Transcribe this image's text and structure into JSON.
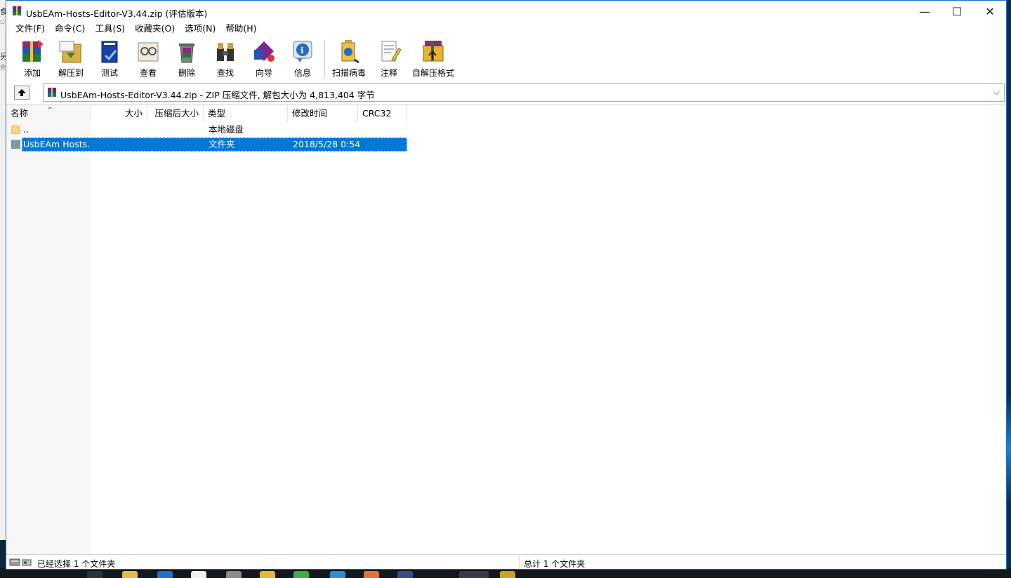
{
  "window": {
    "title": "UsbEAm-Hosts-Editor-V3.44.zip (评估版本)",
    "controls": {
      "minimize": "—",
      "maximize": "☐",
      "close": "✕"
    }
  },
  "menu": [
    {
      "label": "文件(F)"
    },
    {
      "label": "命令(C)"
    },
    {
      "label": "工具(S)"
    },
    {
      "label": "收藏夹(O)"
    },
    {
      "label": "选项(N)"
    },
    {
      "label": "帮助(H)"
    }
  ],
  "toolbar": [
    {
      "label": "添加",
      "icon": "add-archive-icon"
    },
    {
      "label": "解压到",
      "icon": "extract-to-icon"
    },
    {
      "label": "测试",
      "icon": "test-icon"
    },
    {
      "label": "查看",
      "icon": "view-icon"
    },
    {
      "label": "删除",
      "icon": "delete-icon"
    },
    {
      "label": "查找",
      "icon": "find-icon"
    },
    {
      "label": "向导",
      "icon": "wizard-icon"
    },
    {
      "label": "信息",
      "icon": "info-icon"
    },
    {
      "label": "扫描病毒",
      "icon": "virus-scan-icon"
    },
    {
      "label": "注释",
      "icon": "comment-icon"
    },
    {
      "label": "自解压格式",
      "icon": "sfx-icon"
    }
  ],
  "address": {
    "path": "UsbEAm-Hosts-Editor-V3.44.zip - ZIP 压缩文件, 解包大小为 4,813,404 字节"
  },
  "columns": {
    "name": "名称",
    "size": "大小",
    "packed": "压缩后大小",
    "type": "类型",
    "modified": "修改时间",
    "crc": "CRC32",
    "sort_indicator": "^"
  },
  "files": [
    {
      "name": "..",
      "size": "",
      "packed": "",
      "type": "本地磁盘",
      "modified": "",
      "crc": ""
    },
    {
      "name": "UsbEAm Hosts...",
      "size": "",
      "packed": "",
      "type": "文件夹",
      "modified": "2018/5/28 0:54",
      "crc": ""
    }
  ],
  "status": {
    "left": "已经选择 1 个文件夹",
    "right": "总计 1 个文件夹"
  },
  "desktop_fragments": [
    "食",
    "○",
    "另",
    "会"
  ],
  "colors": {
    "selection": "#0078d7",
    "window_border": "#1e6fbf"
  }
}
